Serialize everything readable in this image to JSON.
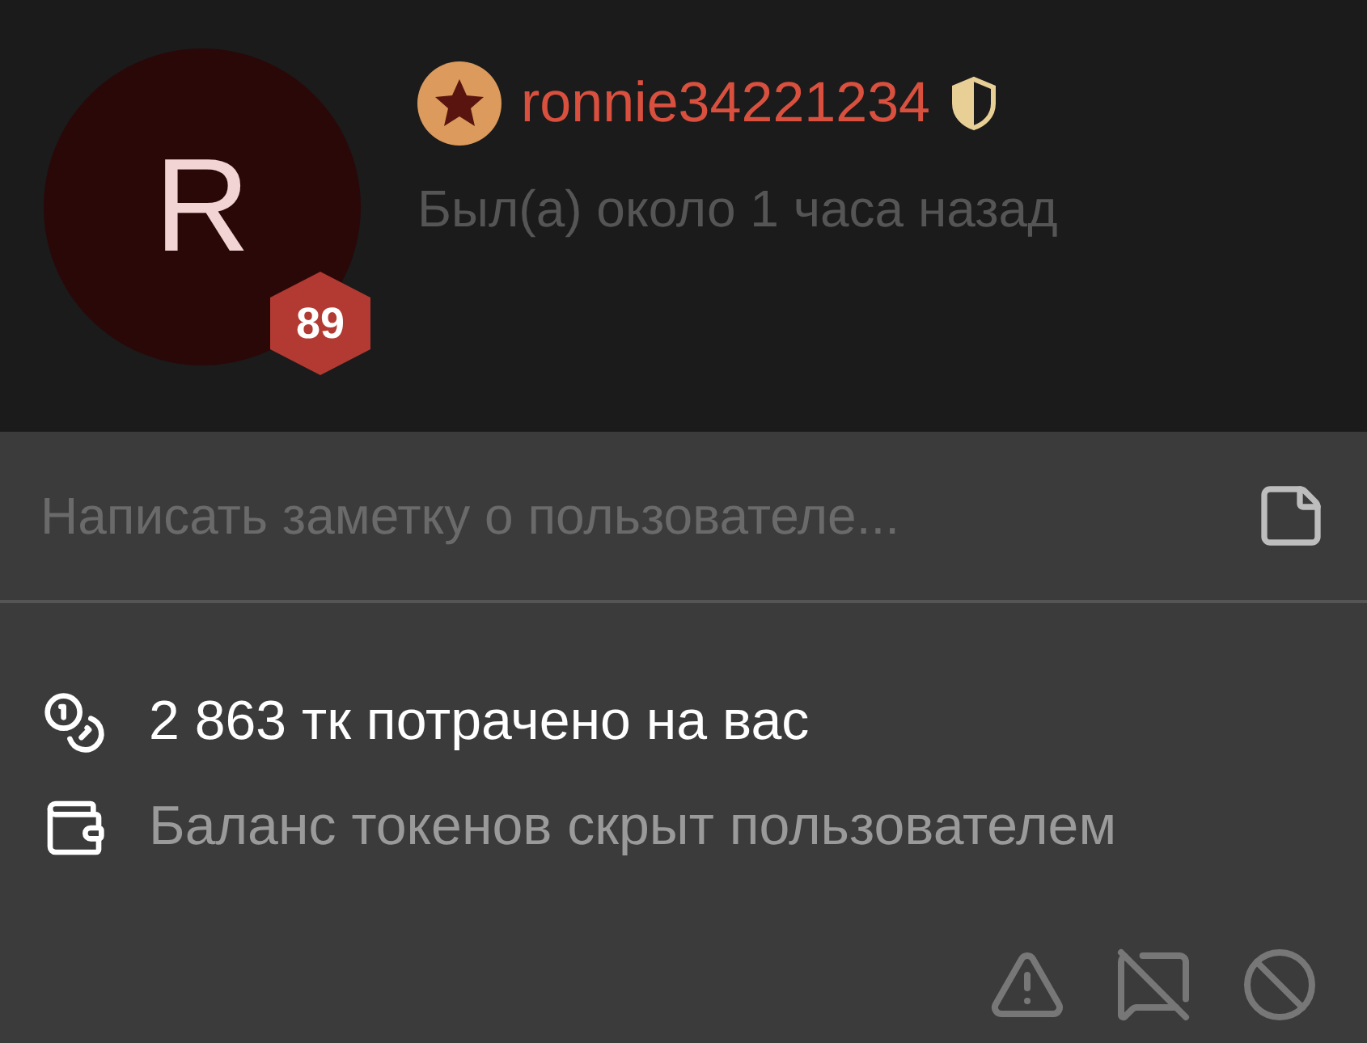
{
  "profile": {
    "avatar_letter": "R",
    "level": "89",
    "username": "ronnie34221234",
    "last_seen": "Был(а) около 1 часа назад"
  },
  "note": {
    "placeholder": "Написать заметку о пользователе..."
  },
  "stats": [
    {
      "kind": "spent",
      "text": "2 863 тк потрачено на вас",
      "dimmed": false
    },
    {
      "kind": "wallet",
      "text": "Баланс токенов скрыт пользователем",
      "dimmed": true
    }
  ]
}
